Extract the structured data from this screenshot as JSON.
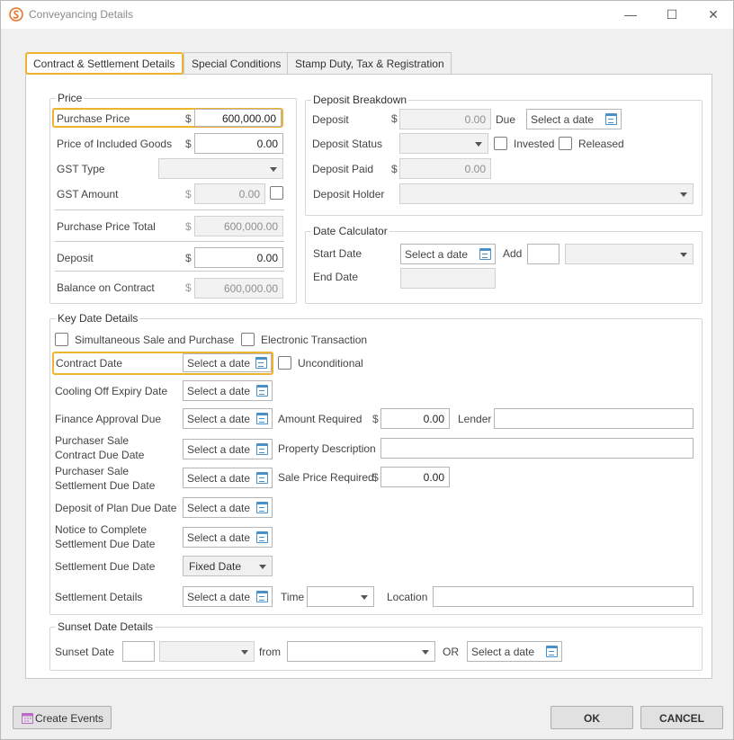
{
  "window": {
    "title": "Conveyancing Details"
  },
  "tabs": [
    "Contract & Settlement Details",
    "Special Conditions",
    "Stamp Duty, Tax & Registration"
  ],
  "currency": "$",
  "date_placeholder": "Select a date",
  "price": {
    "title": "Price",
    "purchase_price_label": "Purchase Price",
    "purchase_price": "600,000.00",
    "included_goods_label": "Price of Included Goods",
    "included_goods": "0.00",
    "gst_type_label": "GST Type",
    "gst_amount_label": "GST Amount",
    "gst_amount": "0.00",
    "total_label": "Purchase Price Total",
    "total": "600,000.00",
    "deposit_label": "Deposit",
    "deposit": "0.00",
    "balance_label": "Balance on Contract",
    "balance": "600,000.00"
  },
  "deposit_breakdown": {
    "title": "Deposit Breakdown",
    "deposit_label": "Deposit",
    "deposit": "0.00",
    "due_label": "Due",
    "status_label": "Deposit Status",
    "invested_label": "Invested",
    "released_label": "Released",
    "paid_label": "Deposit Paid",
    "paid": "0.00",
    "holder_label": "Deposit Holder"
  },
  "date_calculator": {
    "title": "Date Calculator",
    "start_label": "Start Date",
    "add_label": "Add",
    "end_label": "End Date"
  },
  "key_dates": {
    "title": "Key Date Details",
    "simultaneous_label": "Simultaneous Sale and Purchase",
    "electronic_label": "Electronic Transaction",
    "contract_date_label": "Contract Date",
    "unconditional_label": "Unconditional",
    "cooling_off_label": "Cooling Off Expiry Date",
    "finance_label": "Finance Approval Due",
    "amount_required_label": "Amount Required",
    "amount_required": "0.00",
    "lender_label": "Lender",
    "purchaser_contract_label_1": "Purchaser Sale",
    "purchaser_contract_label_2": "Contract Due Date",
    "property_desc_label": "Property Description",
    "purchaser_settlement_label_1": "Purchaser Sale",
    "purchaser_settlement_label_2": "Settlement Due Date",
    "sale_price_label": "Sale Price Required",
    "sale_price": "0.00",
    "plan_deposit_label": "Deposit of Plan Due Date",
    "notice_label_1": "Notice to Complete",
    "notice_label_2": "Settlement Due Date",
    "settlement_due_label": "Settlement Due Date",
    "settlement_due_value": "Fixed Date",
    "settlement_details_label": "Settlement Details",
    "time_label": "Time",
    "location_label": "Location"
  },
  "sunset": {
    "title": "Sunset Date Details",
    "label": "Sunset Date",
    "from_label": "from",
    "or_label": "OR"
  },
  "footer": {
    "create_events": "Create Events",
    "ok": "OK",
    "cancel": "CANCEL"
  },
  "colors": {
    "highlight": "#f0b330",
    "app_icon": "#e8742a"
  }
}
